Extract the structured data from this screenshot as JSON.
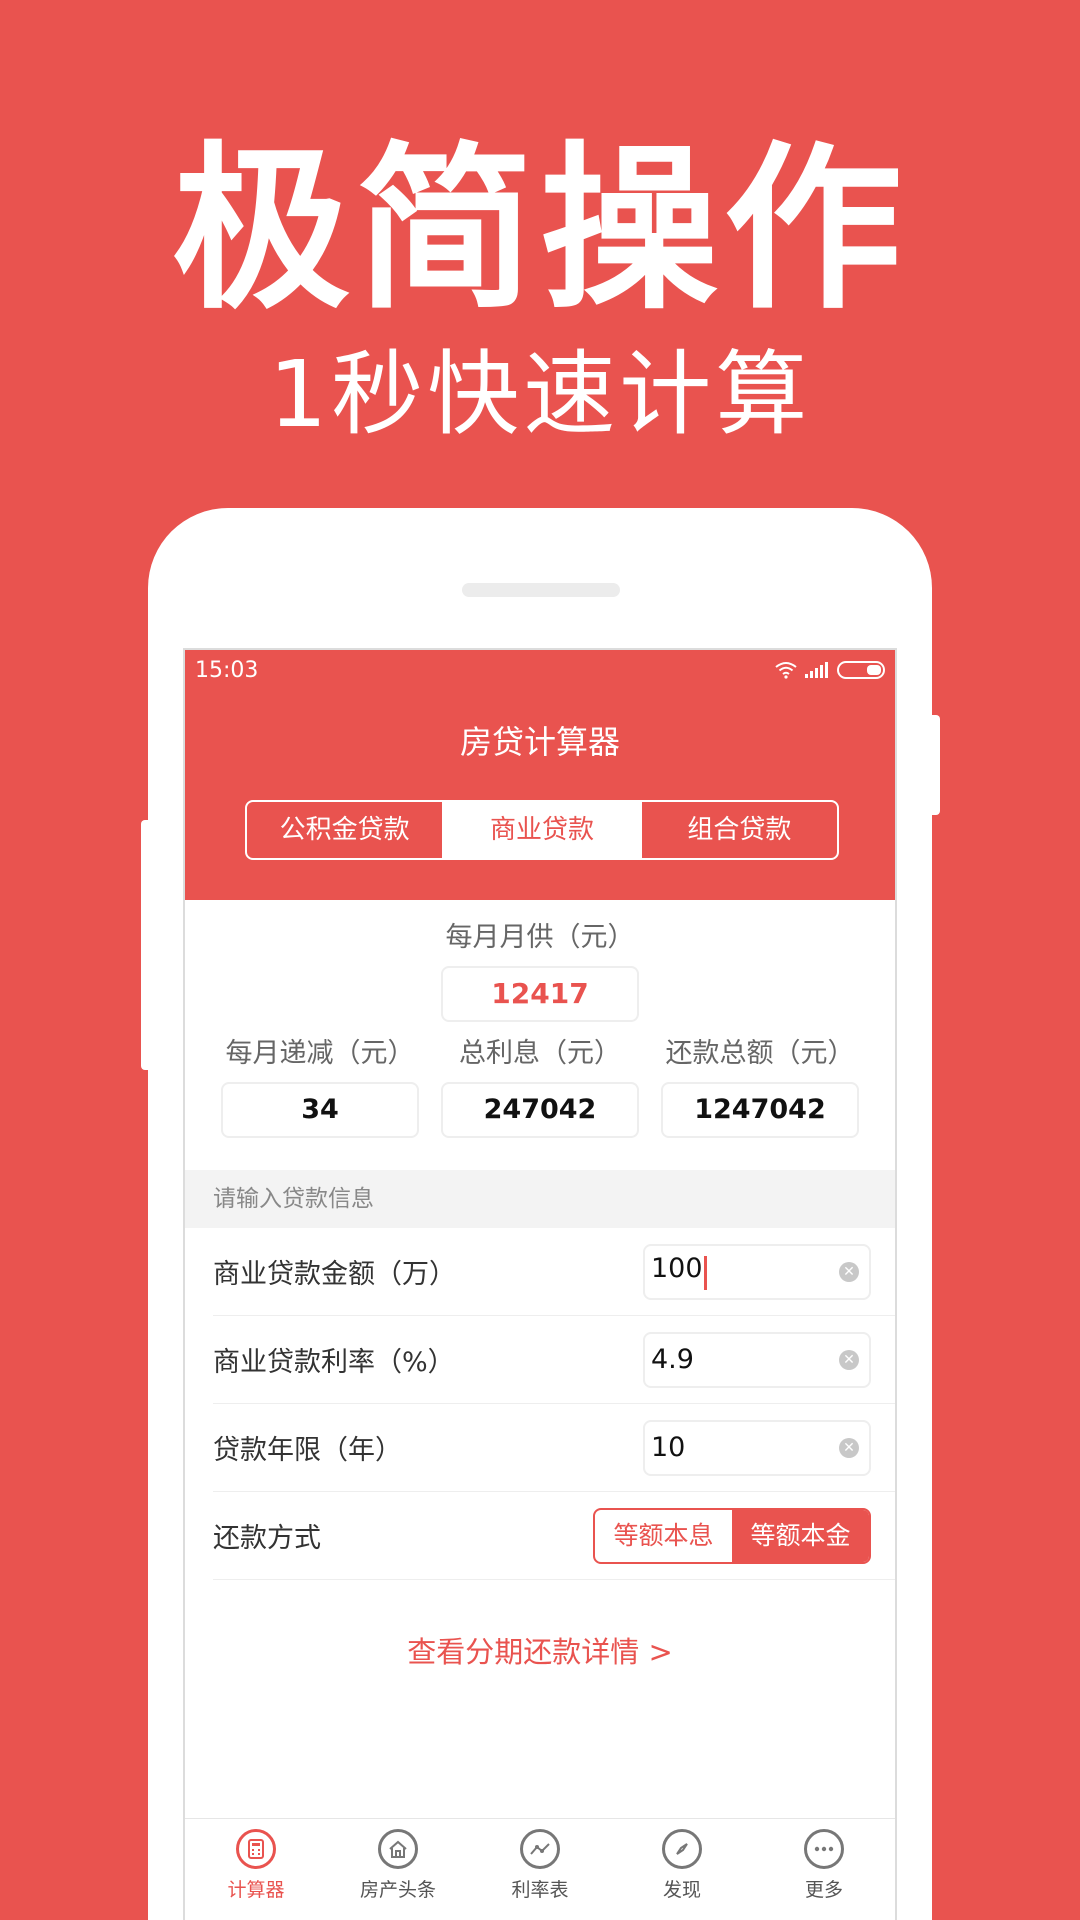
{
  "promo": {
    "title": "极简操作",
    "subtitle": "1秒快速计算"
  },
  "status_bar": {
    "time": "15:03"
  },
  "header": {
    "title": "房贷计算器",
    "tabs": [
      {
        "label": "公积金贷款",
        "active": false
      },
      {
        "label": "商业贷款",
        "active": true
      },
      {
        "label": "组合贷款",
        "active": false
      }
    ]
  },
  "results": {
    "monthly_label": "每月月供（元）",
    "monthly_value": "12417",
    "items": [
      {
        "label": "每月递减（元）",
        "value": "34"
      },
      {
        "label": "总利息（元）",
        "value": "247042"
      },
      {
        "label": "还款总额（元）",
        "value": "1247042"
      }
    ]
  },
  "form": {
    "section_label": "请输入贷款信息",
    "fields": [
      {
        "label": "商业贷款金额（万）",
        "value": "100"
      },
      {
        "label": "商业贷款利率（%）",
        "value": "4.9"
      },
      {
        "label": "贷款年限（年）",
        "value": "10"
      }
    ],
    "repay_label": "还款方式",
    "repay_options": [
      {
        "label": "等额本息",
        "active": false
      },
      {
        "label": "等额本金",
        "active": true
      }
    ]
  },
  "detail_link": "查看分期还款详情 >",
  "tab_bar": [
    {
      "label": "计算器",
      "icon": "calculator-icon",
      "active": true
    },
    {
      "label": "房产头条",
      "icon": "house-icon",
      "active": false
    },
    {
      "label": "利率表",
      "icon": "trend-icon",
      "active": false
    },
    {
      "label": "发现",
      "icon": "compass-icon",
      "active": false
    },
    {
      "label": "更多",
      "icon": "more-icon",
      "active": false
    }
  ],
  "colors": {
    "brand": "#e9534f"
  }
}
